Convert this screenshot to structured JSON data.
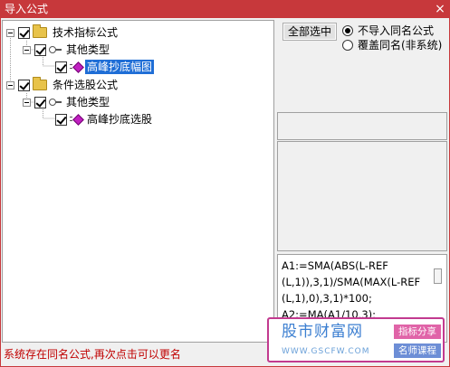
{
  "window": {
    "title": "导入公式",
    "close_glyph": "×",
    "accent_color": "#c7383b"
  },
  "tree": {
    "nodes": [
      {
        "label": "技术指标公式",
        "level": 0,
        "icon": "folder-icon",
        "checked": true,
        "expanded": true
      },
      {
        "label": "其他类型",
        "level": 1,
        "icon": "key-icon",
        "checked": true,
        "expanded": true
      },
      {
        "label": "高峰抄底幅图",
        "level": 2,
        "icon": "formula-icon",
        "checked": true,
        "selected": true
      },
      {
        "label": "条件选股公式",
        "level": 0,
        "icon": "folder-icon",
        "checked": true,
        "expanded": true
      },
      {
        "label": "其他类型",
        "level": 1,
        "icon": "key-icon",
        "checked": true,
        "expanded": true
      },
      {
        "label": "高峰抄底选股",
        "level": 2,
        "icon": "formula-icon",
        "checked": true
      }
    ]
  },
  "controls": {
    "select_all_label": "全部选中",
    "radio_options": [
      {
        "label": "不导入同名公式",
        "selected": true
      },
      {
        "label": "覆盖同名(非系统)",
        "selected": false
      }
    ]
  },
  "code": {
    "lines": [
      "A1:=SMA(ABS(L-REF",
      "(L,1)),3,1)/SMA(MAX(L-REF",
      "(L,1),0),3,1)*100;",
      "A2:=MA(A1/10,3);"
    ]
  },
  "watermark": {
    "site_name": "股市财富网",
    "url": "WWW.GSCFW.COM",
    "tag1": "指标分享",
    "tag2": "名师课程"
  },
  "status": {
    "message": "系统存在同名公式,再次点击可以更名",
    "color": "#c00000"
  }
}
